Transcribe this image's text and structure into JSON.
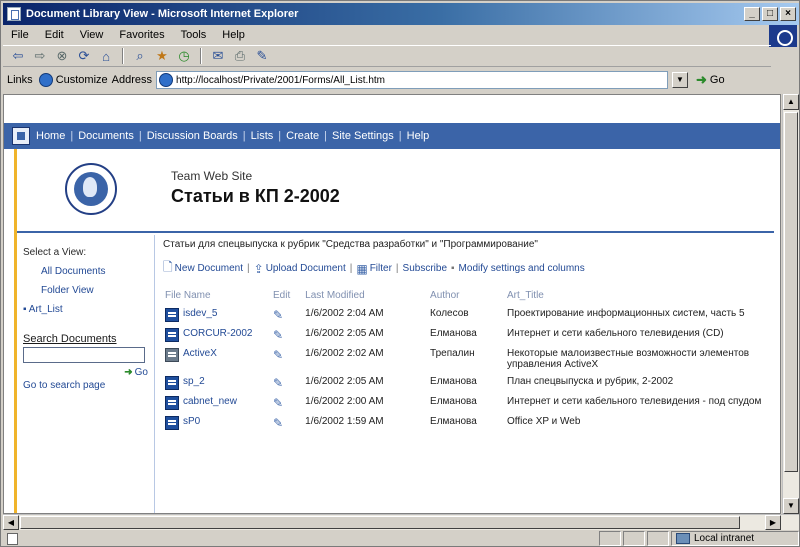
{
  "window": {
    "title": "Document Library View - Microsoft Internet Explorer",
    "controls": [
      "_",
      "□",
      "×"
    ]
  },
  "menu": [
    "File",
    "Edit",
    "View",
    "Favorites",
    "Tools",
    "Help"
  ],
  "toolbar": {
    "icons": [
      "back-icon",
      "forward-icon",
      "stop-icon",
      "refresh-icon",
      "home-icon",
      "search-icon",
      "favorites-icon",
      "history-icon",
      "mail-icon",
      "print-icon",
      "edit-icon"
    ]
  },
  "addressbar": {
    "links_label": "Links",
    "links_item": "Customize",
    "address_label": "Address",
    "url": "http://localhost/Private/2001/Forms/All_List.htm",
    "go_label": "Go"
  },
  "sharepoint": {
    "top_nav": [
      "Home",
      "Documents",
      "Discussion Boards",
      "Lists",
      "Create",
      "Site Settings",
      "Help"
    ],
    "site_name": "Team Web Site",
    "page_title": "Статьи в КП 2-2002",
    "left": {
      "select_view": "Select a View:",
      "views": [
        "All Documents",
        "Folder View"
      ],
      "list_link": "Art_List",
      "search_label": "Search Documents",
      "search_go": "Go",
      "search_page": "Go to search page"
    },
    "description": "Статьи для спецвыпуска к рубрик \"Средства разработки\" и \"Программирование\"",
    "actions": [
      {
        "label": "New Document",
        "icon": "new-document-icon"
      },
      {
        "label": "Upload Document",
        "icon": "upload-icon"
      },
      {
        "label": "Filter",
        "icon": "filter-icon"
      },
      {
        "label": "Subscribe",
        "icon": null
      },
      {
        "label": "Modify settings and columns",
        "icon": null
      }
    ],
    "columns": [
      "File Name",
      "Edit",
      "Last Modified",
      "Author",
      "Art_Title"
    ],
    "rows": [
      {
        "file": "isdev_5",
        "modified": "1/6/2002 2:04 AM",
        "author": "Колесов",
        "title": "Проектирование информационных систем, часть 5",
        "doc_type": "word"
      },
      {
        "file": "CORCUR-2002",
        "modified": "1/6/2002 2:05 AM",
        "author": "Елманова",
        "title": "Интернет и сети кабельного телевидения (CD)",
        "doc_type": "word"
      },
      {
        "file": "ActiveX",
        "modified": "1/6/2002 2:02 AM",
        "author": "Трепалин",
        "title": "Некоторые малоизвестные возможности элементов управления ActiveX",
        "doc_type": "other"
      },
      {
        "file": "sp_2",
        "modified": "1/6/2002 2:05 AM",
        "author": "Елманова",
        "title": "План спецвыпуска и рубрик, 2-2002",
        "doc_type": "word"
      },
      {
        "file": "cabnet_new",
        "modified": "1/6/2002 2:00 AM",
        "author": "Елманова",
        "title": "Интернет и сети кабельного телевидения - под спудом",
        "doc_type": "word"
      },
      {
        "file": "sP0",
        "modified": "1/6/2002 1:59 AM",
        "author": "Елманова",
        "title": "Office XP и Web",
        "doc_type": "word"
      }
    ]
  },
  "status": {
    "zone": "Local intranet"
  }
}
